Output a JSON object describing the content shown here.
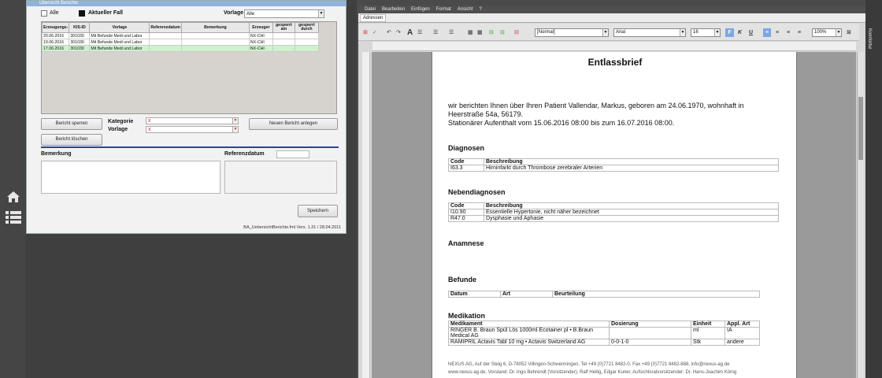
{
  "sidebar": {
    "home_icon": "home-icon",
    "list_icon": "list-icon"
  },
  "berichte": {
    "title": "Übersicht Berichte",
    "alle_label": "Alle",
    "aktueller_fall_label": "Aktueller Fall",
    "vorlage_label": "Vorlage",
    "vorlage_value": "Alle",
    "columns": [
      "Erzeugungs-",
      "KIS-ID",
      "Vorlage",
      "Referenzdatum",
      "Bemerkung",
      "Erzeuger",
      "gesperrt am",
      "gesperrt durch"
    ],
    "rows": [
      [
        "20.06.2016",
        "301030",
        "Mit Befunde Medi und Labor",
        "",
        "",
        "NX-CHI",
        "",
        ""
      ],
      [
        "19.06.2016",
        "301030",
        "Mit Befunde Medi und Labor",
        "",
        "",
        "NX-CHI",
        "",
        ""
      ],
      [
        "17.06.2016",
        "301030",
        "Mit Befunde Medi und Labor",
        "",
        "",
        "NX-CHI",
        "",
        ""
      ]
    ],
    "btn_sperren": "Bericht sperren",
    "btn_loeschen": "Bericht löschen",
    "kategorie_label": "Kategorie",
    "vorlage2_label": "Vorlage",
    "btn_neu": "Neuen Bericht anlegen",
    "bemerkung_label": "Bemerkung",
    "referenzdatum_label": "Referenzdatum",
    "btn_speichern": "Speichern",
    "footer": "BA_UebersichtBerichte.fml  Vers. 1.31 / 28.04.2011"
  },
  "word": {
    "menu": [
      "Datei",
      "Bearbeiten",
      "Einfügen",
      "Format",
      "Ansicht",
      "?"
    ],
    "tab": "Adressen",
    "style_value": "[Normal]",
    "font_value": "Arial",
    "size_value": "16",
    "zoom_value": "100%",
    "side_label": "Komfortur",
    "doc": {
      "title": "Entlassbrief",
      "intro1": "wir berichten Ihnen über Ihren Patient Vallendar, Markus, geboren am 24.06.1970, wohnhaft in",
      "intro2": "Heerstraße  54a, 56179.",
      "intro3": "Stationärer Aufenthalt vom 15.06.2016 08:00 bis zum 16.07.2016 08:00.",
      "diagnosen": "Diagnosen",
      "diag_cols": [
        "Code",
        "Beschreibung"
      ],
      "diag_rows": [
        [
          "I63.3",
          "Hirninfarkt durch Thrombose zerebraler Arterien"
        ]
      ],
      "nebendiagnosen": "Nebendiagnosen",
      "neben_rows": [
        [
          "I10.90",
          "Essentielle Hypertonie, nicht näher bezeichnet"
        ],
        [
          "R47.0",
          "Dysphasie und Aphasie"
        ]
      ],
      "anamnese": "Anamnese",
      "befunde": "Befunde",
      "befunde_cols": [
        "Datum",
        "Art",
        "Beurteilung"
      ],
      "medikation": "Medikation",
      "med_cols": [
        "Medikament",
        "Dosierung",
        "Einheit",
        "Appl. Art"
      ],
      "med_rows": [
        [
          "RINGER B. Braun Spül Lös 1000ml Ecotainer pl • B.Braun Medical AG",
          "",
          "ml",
          "IA"
        ],
        [
          "RAMIPRIL Actavis Tabl 10 mg • Actavis Switzerland AG",
          "0-0-1-0",
          "Stk",
          "andere"
        ]
      ],
      "footer1": "NEXUS AG, Auf der Steig 6, D-78052 Villingen-Schwenningen, Tel +49 (0)7721 8482-0, Fax +49 (0)7721 8482-888, info@nexus-ag.de",
      "footer2": "www.nexus-ag.de, Vorstand: Dr. Ingo Behrendt (Vorsitzender), Ralf Heilig, Edgar Kuner, Aufsichtsratvorsitzender: Dr. Hans-Joachim König"
    }
  }
}
